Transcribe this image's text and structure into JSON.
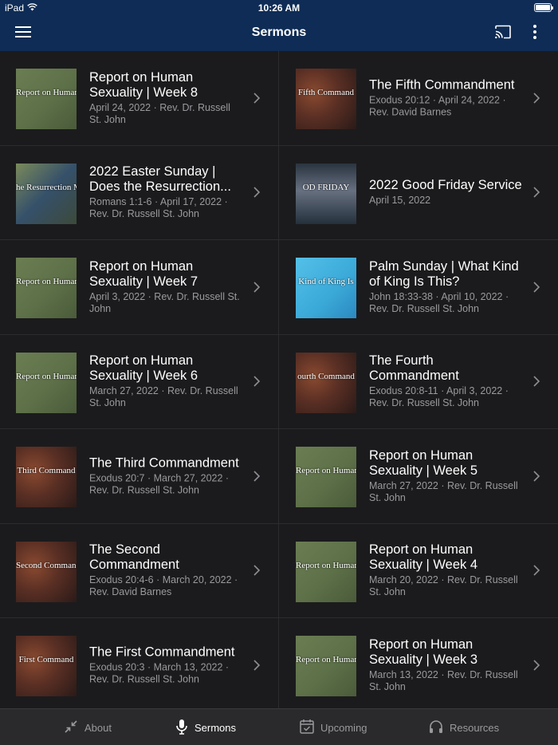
{
  "status": {
    "device": "iPad",
    "time": "10:26 AM"
  },
  "nav": {
    "title": "Sermons"
  },
  "sermons": [
    {
      "title": "Report on Human Sexuality | Week 8",
      "meta": "April 24, 2022 · Rev. Dr. Russell St. John",
      "thumb": "green",
      "thumb_text": "Report on Human Se"
    },
    {
      "title": "The Fifth Commandment",
      "meta": "Exodus 20:12 · April 24, 2022 · Rev. David Barnes",
      "thumb": "warm",
      "thumb_text": "Fifth Command"
    },
    {
      "title": "2022 Easter Sunday | Does the Resurrection...",
      "meta": "Romans 1:1-6 · April 17, 2022 · Rev. Dr. Russell St. John",
      "thumb": "easter",
      "thumb_text": "he Resurrection M"
    },
    {
      "title": "2022 Good Friday Service",
      "meta": "April 15, 2022",
      "thumb": "friday",
      "thumb_text": "OD FRIDAY"
    },
    {
      "title": "Report on Human Sexuality | Week 7",
      "meta": "April 3, 2022 · Rev. Dr. Russell St. John",
      "thumb": "green",
      "thumb_text": "Report on Human Se"
    },
    {
      "title": "Palm Sunday | What Kind of King Is This?",
      "meta": "John 18:33-38 · April 10, 2022 · Rev. Dr. Russell St. John",
      "thumb": "palm",
      "thumb_text": "Kind of King Is"
    },
    {
      "title": "Report on Human Sexuality | Week 6",
      "meta": "March 27, 2022 · Rev. Dr. Russell St. John",
      "thumb": "green",
      "thumb_text": "Report on Human Se"
    },
    {
      "title": "The Fourth Commandment",
      "meta": "Exodus 20:8-11 · April 3, 2022 · Rev. Dr. Russell St. John",
      "thumb": "warm",
      "thumb_text": "ourth Command"
    },
    {
      "title": "The Third Commandment",
      "meta": "Exodus 20:7 · March 27, 2022 · Rev. Dr. Russell St. John",
      "thumb": "warm",
      "thumb_text": "Third Command"
    },
    {
      "title": "Report on Human Sexuality | Week 5",
      "meta": "March 27, 2022 · Rev. Dr. Russell St. John",
      "thumb": "green",
      "thumb_text": "Report on Human Se"
    },
    {
      "title": "The Second Commandment",
      "meta": "Exodus 20:4-6 · March 20, 2022 · Rev. David Barnes",
      "thumb": "warm",
      "thumb_text": "Second Command"
    },
    {
      "title": "Report on Human Sexuality | Week 4",
      "meta": "March 20, 2022 · Rev. Dr. Russell St. John",
      "thumb": "green",
      "thumb_text": "Report on Human Se"
    },
    {
      "title": "The First Commandment",
      "meta": "Exodus 20:3 · March 13, 2022 · Rev. Dr. Russell St. John",
      "thumb": "warm",
      "thumb_text": "First Command"
    },
    {
      "title": "Report on Human Sexuality | Week 3",
      "meta": "March 13, 2022 · Rev. Dr. Russell St. John",
      "thumb": "green",
      "thumb_text": "Report on Human Se"
    }
  ],
  "thumb_styles": {
    "green": "#5d7048",
    "warm": "#5a2f24",
    "easter": "#3d4a3a",
    "friday": "#3a4450",
    "palm": "#3aa9d8"
  },
  "tabs": [
    {
      "label": "About",
      "icon": "collapse-arrows-icon",
      "active": false
    },
    {
      "label": "Sermons",
      "icon": "microphone-icon",
      "active": true
    },
    {
      "label": "Upcoming",
      "icon": "calendar-check-icon",
      "active": false
    },
    {
      "label": "Resources",
      "icon": "headphones-icon",
      "active": false
    }
  ],
  "colors": {
    "navbar": "#0e2c55",
    "background": "#1b1b1d",
    "meta_text": "#9a9a9e",
    "tabbar": "#2a2a2c"
  }
}
